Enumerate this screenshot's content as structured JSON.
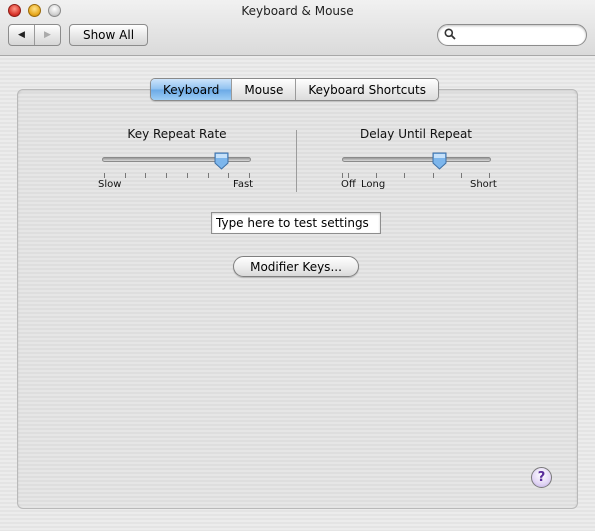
{
  "window": {
    "title": "Keyboard & Mouse"
  },
  "toolbar": {
    "back_icon": "◀",
    "forward_icon": "▶",
    "show_all_label": "Show All",
    "search_placeholder": "",
    "search_icon": "⚲"
  },
  "tabs": [
    {
      "label": "Keyboard",
      "active": true
    },
    {
      "label": "Mouse",
      "active": false
    },
    {
      "label": "Keyboard Shortcuts",
      "active": false
    }
  ],
  "key_repeat": {
    "title": "Key Repeat Rate",
    "min_label": "Slow",
    "max_label": "Fast",
    "value_fraction": 0.8
  },
  "delay_until_repeat": {
    "title": "Delay Until Repeat",
    "off_label": "Off",
    "min_label": "Long",
    "max_label": "Short",
    "value_fraction": 0.64
  },
  "test_field": {
    "value": "Type here to test settings"
  },
  "modifier_keys_label": "Modifier Keys...",
  "help_label": "?",
  "colors": {
    "active_tab": "#8ec1f0",
    "help_accent": "#5a2d9c"
  }
}
